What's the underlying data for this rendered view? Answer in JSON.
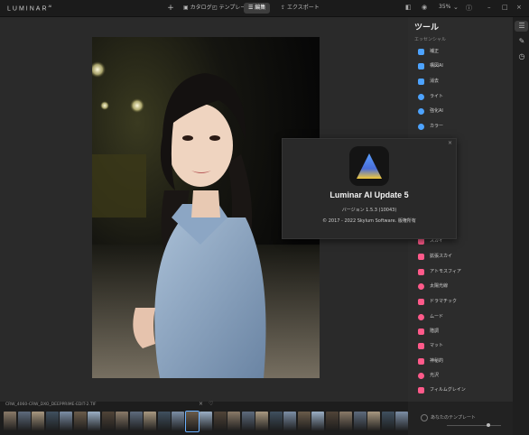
{
  "app": {
    "logo": "LUMINAR",
    "logo_sup": "AI"
  },
  "topbar": {
    "add": "+",
    "catalog": "カタログ",
    "templates": "テンプレート",
    "edit": "編集",
    "export": "エクスポート",
    "zoom": "35%"
  },
  "tools": {
    "title": "ツール",
    "subtitle": "エッセンシャル",
    "items": [
      {
        "label": "補正",
        "icon": "crop-icon",
        "color": "#4da3ff"
      },
      {
        "label": "構図AI",
        "icon": "composition-icon",
        "color": "#4da3ff"
      },
      {
        "label": "消去",
        "icon": "erase-icon",
        "color": "#4da3ff"
      },
      {
        "label": "ライト",
        "icon": "light-icon",
        "color": "#4da3ff"
      },
      {
        "label": "強化AI",
        "icon": "enhance-icon",
        "color": "#4da3ff"
      },
      {
        "label": "カラー",
        "icon": "color-icon",
        "color": "#4da3ff"
      },
      {
        "label": "スカイ",
        "icon": "sky-icon",
        "color": "#ff5a8a"
      },
      {
        "label": "拡張スカイ",
        "icon": "sky-aug-icon",
        "color": "#ff5a8a"
      },
      {
        "label": "アトモスフィア",
        "icon": "atmosphere-icon",
        "color": "#ff5a8a"
      },
      {
        "label": "太陽光線",
        "icon": "sunrays-icon",
        "color": "#ff5a8a"
      },
      {
        "label": "ドラマチック",
        "icon": "dramatic-icon",
        "color": "#ff5a8a"
      },
      {
        "label": "ムード",
        "icon": "mood-icon",
        "color": "#ff5a8a"
      },
      {
        "label": "階調",
        "icon": "toning-icon",
        "color": "#ff5a8a"
      },
      {
        "label": "マット",
        "icon": "matte-icon",
        "color": "#ff5a8a"
      },
      {
        "label": "神秘的",
        "icon": "mystical-icon",
        "color": "#ff5a8a"
      },
      {
        "label": "光沢",
        "icon": "glow-icon",
        "color": "#ff5a8a"
      },
      {
        "label": "フィルムグレイン",
        "icon": "grain-icon",
        "color": "#ff5a8a"
      }
    ]
  },
  "about": {
    "close": "×",
    "title": "Luminar AI Update 5",
    "version": "バージョン 1.5.3 (10043)",
    "copyright": "© 2017 - 2022 Skylum Software. 版権所有"
  },
  "filmstrip": {
    "filename": "CRW_4060-CRW_DXO_DEEPPRIME-EDIT-2.TIF",
    "close": "×",
    "favorite": "♡"
  },
  "presets": {
    "label": "あなたのテンプレート"
  }
}
